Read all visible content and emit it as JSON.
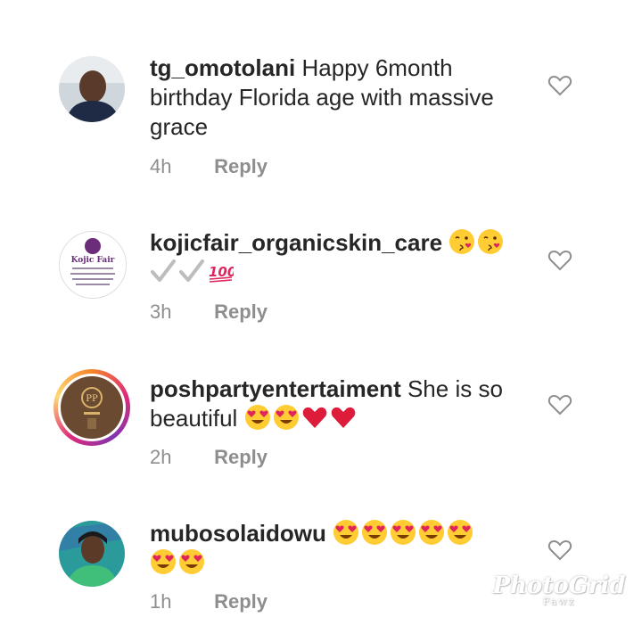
{
  "comments": [
    {
      "username": "tg_omotolani",
      "text": "Happy 6month birthday Florida age with massive grace",
      "time": "4h",
      "reply_label": "Reply",
      "emojis": []
    },
    {
      "username": "kojicfair_organicskin_care",
      "text": "",
      "time": "3h",
      "reply_label": "Reply",
      "avatar_brand": "Kojic Fair",
      "emojis": [
        "kissing-heart",
        "kissing-heart",
        "check",
        "check",
        "hundred"
      ]
    },
    {
      "username": "poshpartyentertaiment",
      "text": "She is so beautiful",
      "time": "2h",
      "reply_label": "Reply",
      "emojis": [
        "heart-eyes",
        "heart-eyes",
        "red-heart",
        "red-heart"
      ]
    },
    {
      "username": "mubosolaidowu",
      "text": "",
      "time": "1h",
      "reply_label": "Reply",
      "emojis": [
        "heart-eyes",
        "heart-eyes",
        "heart-eyes",
        "heart-eyes",
        "heart-eyes",
        "heart-eyes",
        "heart-eyes"
      ]
    }
  ],
  "watermark": {
    "brand": "PhotoGrid",
    "sub": "Fawz"
  },
  "colors": {
    "text": "#262626",
    "meta": "#8e8e8e",
    "heart_outline": "#8e8e8e"
  }
}
